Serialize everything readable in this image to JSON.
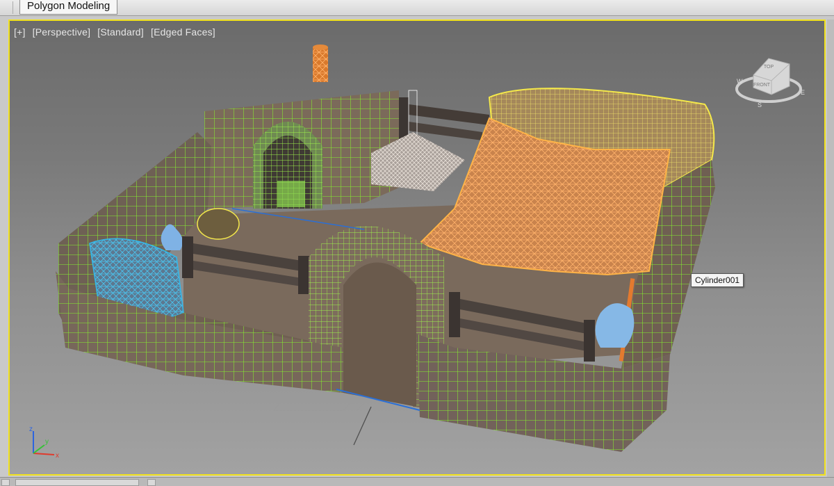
{
  "ribbon": {
    "active_tab": "Polygon Modeling"
  },
  "viewport": {
    "labels": [
      "[+]",
      "[Perspective]",
      "[Standard]",
      "[Edged Faces]"
    ],
    "active_border_color": "#f2e21c"
  },
  "tooltip": {
    "object_name": "Cylinder001"
  },
  "viewcube": {
    "top_label": "TOP",
    "front_label": "FRONT",
    "compass": [
      "W",
      "S",
      "E"
    ]
  },
  "axis_gizmo": {
    "x": "x",
    "y": "y",
    "z": "z"
  },
  "colors": {
    "wire_green": "#7cf02a",
    "wire_orange": "#ff9a3a",
    "wire_blue": "#35b7e8",
    "wire_yellow": "#f5e94a"
  }
}
